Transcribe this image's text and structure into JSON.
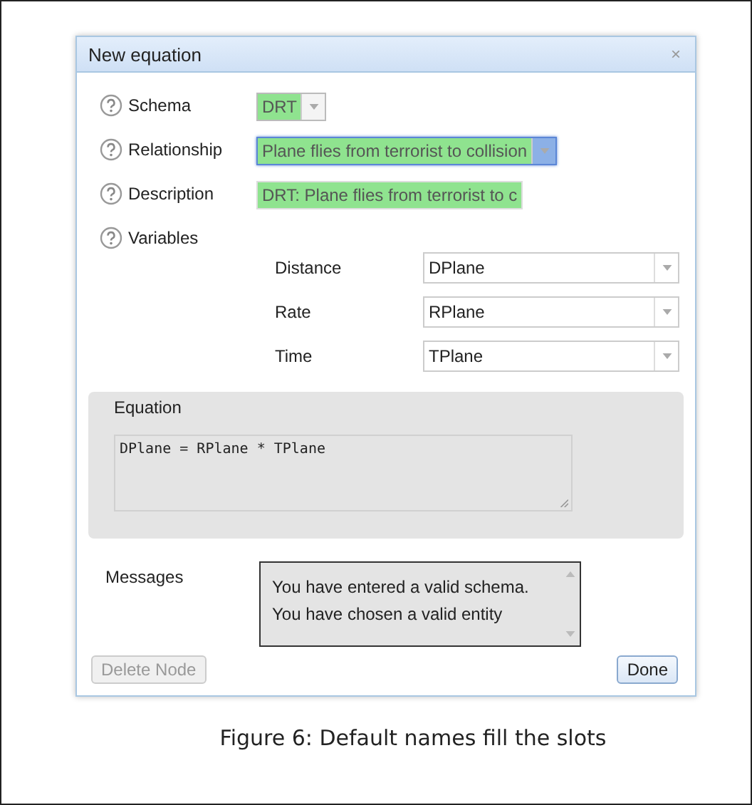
{
  "dialog": {
    "title": "New equation",
    "close": "×",
    "fields": [
      {
        "label": "Schema",
        "kind": "select",
        "value": "DRT",
        "valid": true,
        "focused": false
      },
      {
        "label": "Relationship",
        "kind": "select",
        "value": "Plane flies from terrorist to collision",
        "valid": true,
        "focused": true
      },
      {
        "label": "Description",
        "kind": "text",
        "value": "DRT: Plane flies from terrorist to c",
        "valid": true,
        "focused": false
      }
    ],
    "variables": {
      "label": "Variables",
      "rows": [
        {
          "name": "Distance",
          "value": "DPlane"
        },
        {
          "name": "Rate",
          "value": "RPlane"
        },
        {
          "name": "Time",
          "value": "TPlane"
        }
      ]
    },
    "equation": {
      "label": "Equation",
      "value": "DPlane = RPlane * TPlane"
    },
    "messages": {
      "label": "Messages",
      "lines": [
        "You have entered a valid schema.",
        "You have chosen a valid entity"
      ]
    },
    "buttons": [
      {
        "label": "Delete Node",
        "disabled": true
      },
      {
        "label": "Done",
        "disabled": false
      }
    ]
  },
  "caption": "Figure 6: Default names fill the slots"
}
